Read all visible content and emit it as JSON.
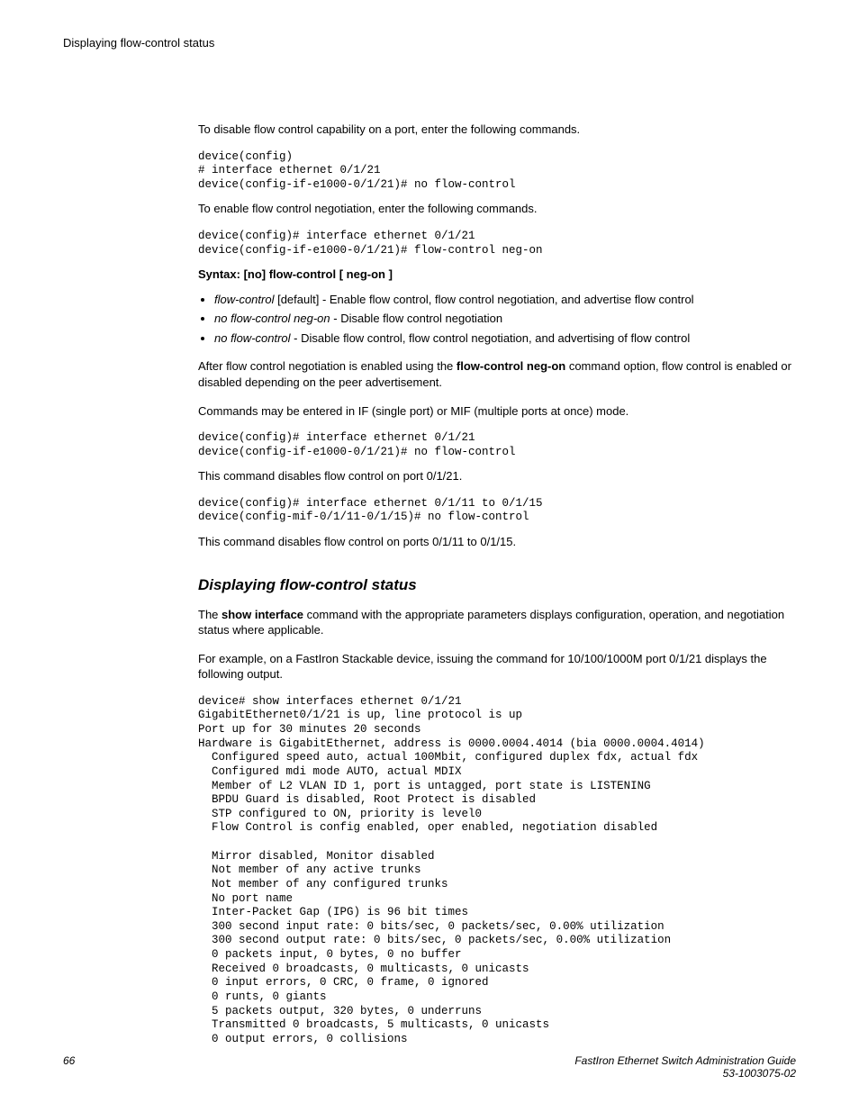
{
  "header": {
    "title": "Displaying flow-control status"
  },
  "body": {
    "p1": "To disable flow control capability on a port, enter the following commands.",
    "code1": "device(config)\n# interface ethernet 0/1/21\ndevice(config-if-e1000-0/1/21)# no flow-control",
    "p2": "To enable flow control negotiation, enter the following commands.",
    "code2": "device(config)# interface ethernet 0/1/21\ndevice(config-if-e1000-0/1/21)# flow-control neg-on",
    "syntax_prefix": "Syntax: [no] flow-control",
    "syntax_lb": " [ ",
    "syntax_opt": "neg-on",
    "syntax_rb": " ]",
    "bullets": [
      {
        "term": "flow-control",
        "rest": " [default] - Enable flow control, flow control negotiation, and advertise flow control"
      },
      {
        "term": "no flow-control neg-on",
        "rest": " - Disable flow control negotiation"
      },
      {
        "term": "no flow-control",
        "rest": " - Disable flow control, flow control negotiation, and advertising of flow control"
      }
    ],
    "p3_a": "After flow control negotiation is enabled using the ",
    "p3_b": "flow-control neg-on",
    "p3_c": " command option, flow control is enabled or disabled depending on the peer advertisement.",
    "p4": "Commands may be entered in IF (single port) or MIF (multiple ports at once) mode.",
    "code3": "device(config)# interface ethernet 0/1/21\ndevice(config-if-e1000-0/1/21)# no flow-control",
    "p5": "This command disables flow control on port 0/1/21.",
    "code4": "device(config)# interface ethernet 0/1/11 to 0/1/15\ndevice(config-mif-0/1/11-0/1/15)# no flow-control",
    "p6": "This command disables flow control on ports 0/1/11 to 0/1/15.",
    "section_title": "Displaying flow-control status",
    "p7_a": "The ",
    "p7_b": "show interface",
    "p7_c": " command with the appropriate parameters displays configuration, operation, and negotiation status where applicable.",
    "p8": "For example, on a FastIron Stackable device, issuing the command for 10/100/1000M port 0/1/21 displays the following output.",
    "code5": "device# show interfaces ethernet 0/1/21\nGigabitEthernet0/1/21 is up, line protocol is up\nPort up for 30 minutes 20 seconds\nHardware is GigabitEthernet, address is 0000.0004.4014 (bia 0000.0004.4014)\n  Configured speed auto, actual 100Mbit, configured duplex fdx, actual fdx\n  Configured mdi mode AUTO, actual MDIX\n  Member of L2 VLAN ID 1, port is untagged, port state is LISTENING\n  BPDU Guard is disabled, Root Protect is disabled\n  STP configured to ON, priority is level0\n  Flow Control is config enabled, oper enabled, negotiation disabled\n\n  Mirror disabled, Monitor disabled\n  Not member of any active trunks\n  Not member of any configured trunks\n  No port name\n  Inter-Packet Gap (IPG) is 96 bit times\n  300 second input rate: 0 bits/sec, 0 packets/sec, 0.00% utilization\n  300 second output rate: 0 bits/sec, 0 packets/sec, 0.00% utilization\n  0 packets input, 0 bytes, 0 no buffer\n  Received 0 broadcasts, 0 multicasts, 0 unicasts\n  0 input errors, 0 CRC, 0 frame, 0 ignored\n  0 runts, 0 giants\n  5 packets output, 320 bytes, 0 underruns\n  Transmitted 0 broadcasts, 5 multicasts, 0 unicasts\n  0 output errors, 0 collisions"
  },
  "footer": {
    "page_number": "66",
    "doc_title": "FastIron Ethernet Switch Administration Guide",
    "doc_number": "53-1003075-02"
  }
}
